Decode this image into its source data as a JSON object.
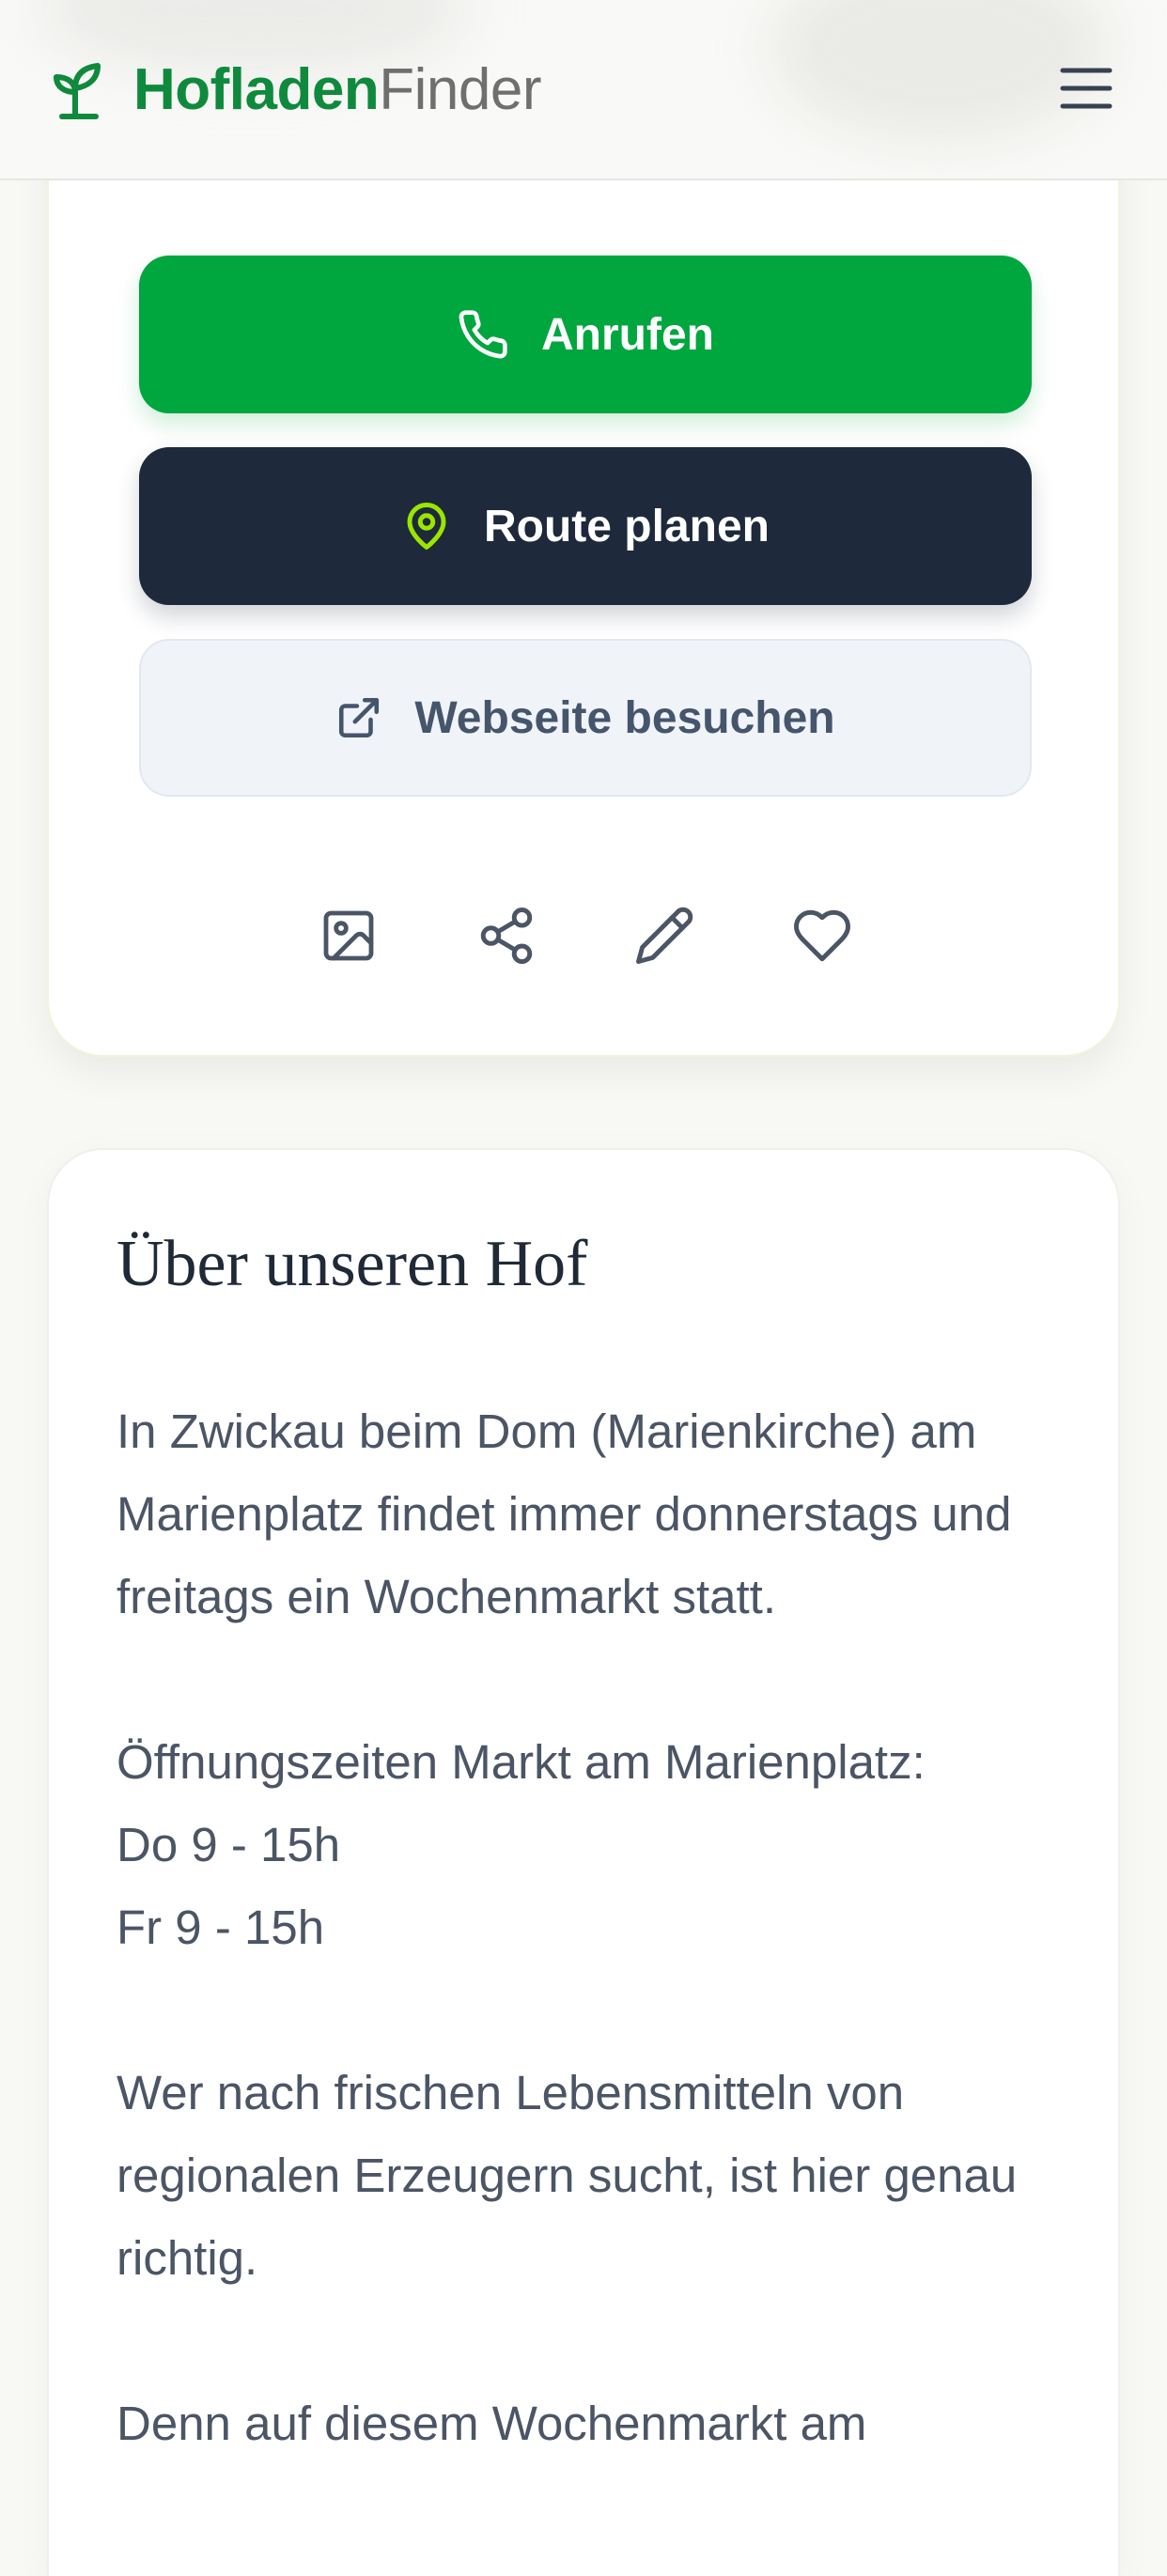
{
  "header": {
    "brand_strong": "Hofladen",
    "brand_light": "Finder",
    "logo_icon": "sprout-icon",
    "menu_icon": "hamburger-menu-icon"
  },
  "actions": {
    "call_label": "Anrufen",
    "route_label": "Route planen",
    "website_label": "Webseite besuchen",
    "icons": [
      "image-icon",
      "share-icon",
      "edit-pencil-icon",
      "heart-icon"
    ]
  },
  "about": {
    "title": "Über unseren Hof",
    "text": "In Zwickau beim Dom (Marienkirche) am Marienplatz findet immer donnerstags und freitags ein Wochenmarkt statt.\n\nÖffnungszeiten Markt am Marienplatz:\nDo 9 - 15h\nFr 9 - 15h\n\nWer nach frischen Lebensmitteln von regionalen Erzeugern sucht, ist hier genau richtig.\n\nDenn auf diesem Wochenmarkt am"
  },
  "colors": {
    "brand_green": "#0f8a3c",
    "call_button": "#00a63e",
    "route_button": "#1e293b",
    "route_pin": "#9ae600",
    "website_button": "#f0f3f8",
    "text_muted": "#4b5565"
  }
}
